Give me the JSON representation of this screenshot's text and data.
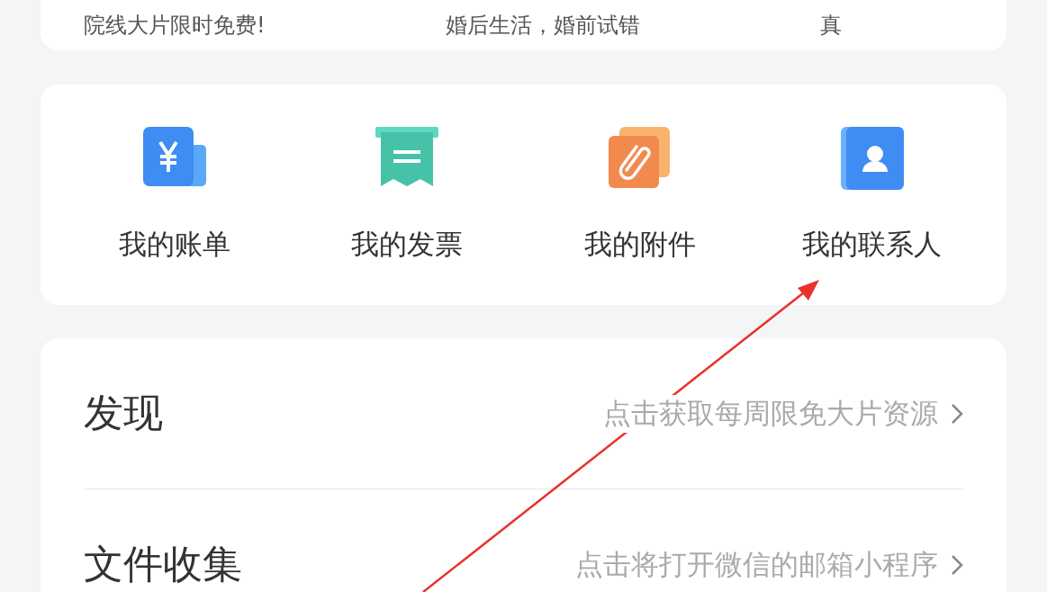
{
  "banner_items": [
    {
      "text": "院线大片限时免费!"
    },
    {
      "text": "婚后生活，婚前试错"
    },
    {
      "text": "真"
    }
  ],
  "shortcuts": [
    {
      "kind": "bill",
      "label": "我的账单"
    },
    {
      "kind": "invoice",
      "label": "我的发票"
    },
    {
      "kind": "attachment",
      "label": "我的附件"
    },
    {
      "kind": "contacts",
      "label": "我的联系人"
    }
  ],
  "list_items": [
    {
      "title": "发现",
      "hint": "点击获取每周限免大片资源"
    },
    {
      "title": "文件收集",
      "hint": "点击将打开微信的邮箱小程序"
    }
  ]
}
